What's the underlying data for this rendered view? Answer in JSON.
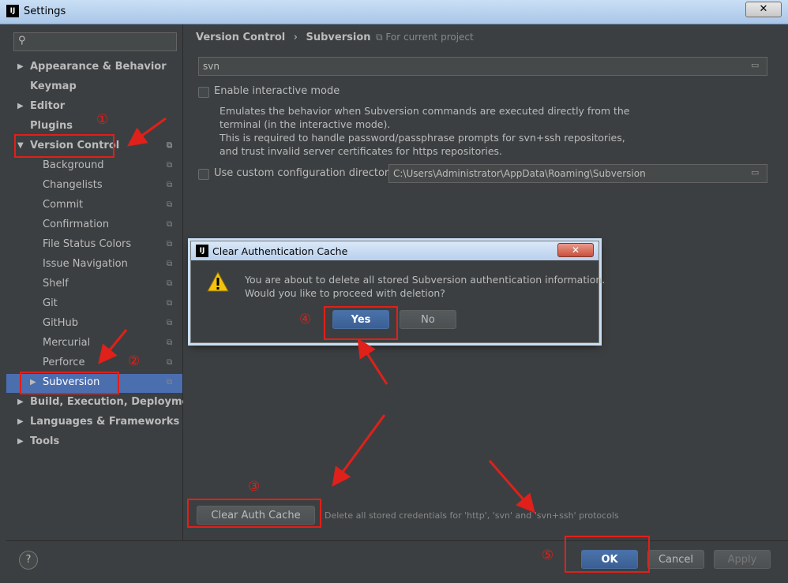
{
  "window": {
    "title": "Settings",
    "close_label": "✕"
  },
  "search": {
    "placeholder": ""
  },
  "tree": [
    {
      "label": "Appearance & Behavior",
      "bold": true,
      "arrow": "▶"
    },
    {
      "label": "Keymap",
      "bold": true
    },
    {
      "label": "Editor",
      "bold": true,
      "arrow": "▶"
    },
    {
      "label": "Plugins",
      "bold": true
    },
    {
      "label": "Version Control",
      "bold": true,
      "arrow": "▼"
    },
    {
      "label": "Background"
    },
    {
      "label": "Changelists"
    },
    {
      "label": "Commit"
    },
    {
      "label": "Confirmation"
    },
    {
      "label": "File Status Colors"
    },
    {
      "label": "Issue Navigation"
    },
    {
      "label": "Shelf"
    },
    {
      "label": "Git"
    },
    {
      "label": "GitHub"
    },
    {
      "label": "Mercurial"
    },
    {
      "label": "Perforce"
    },
    {
      "label": "Subversion",
      "arrow": "▶",
      "selected": true
    },
    {
      "label": "Build, Execution, Deployment",
      "bold": true,
      "arrow": "▶"
    },
    {
      "label": "Languages & Frameworks",
      "bold": true,
      "arrow": "▶"
    },
    {
      "label": "Tools",
      "bold": true,
      "arrow": "▶"
    }
  ],
  "breadcrumb": {
    "part1": "Version Control",
    "sep": "›",
    "part2": "Subversion",
    "project_label": "For current project"
  },
  "svn_path": "svn",
  "interactive": {
    "label": "Enable interactive mode",
    "desc1": "Emulates the behavior when Subversion commands are executed directly from the",
    "desc2": "terminal (in the interactive mode).",
    "desc3": "This is required to handle password/passphrase prompts for svn+ssh repositories,",
    "desc4": "and trust invalid server certificates for https repositories."
  },
  "config_dir": {
    "label": "Use custom configuration directory:",
    "value": "C:\\Users\\Administrator\\AppData\\Roaming\\Subversion"
  },
  "auth_cache": {
    "button": "Clear Auth Cache",
    "desc": "Delete all stored credentials for 'http', 'svn' and 'svn+ssh' protocols"
  },
  "footer": {
    "help": "?",
    "ok": "OK",
    "cancel": "Cancel",
    "apply": "Apply"
  },
  "dialog": {
    "title": "Clear Authentication Cache",
    "close_label": "✕",
    "line1": "You are about to delete all stored Subversion authentication information.",
    "line2": "Would you like to proceed with deletion?",
    "yes": "Yes",
    "no": "No"
  },
  "annotations": {
    "n1": "①",
    "n2": "②",
    "n3": "③",
    "n4": "④",
    "n5": "⑤"
  },
  "colors": {
    "annotation_red": "#e0201a",
    "selection": "#4b6eaf",
    "background": "#3c3f41"
  }
}
